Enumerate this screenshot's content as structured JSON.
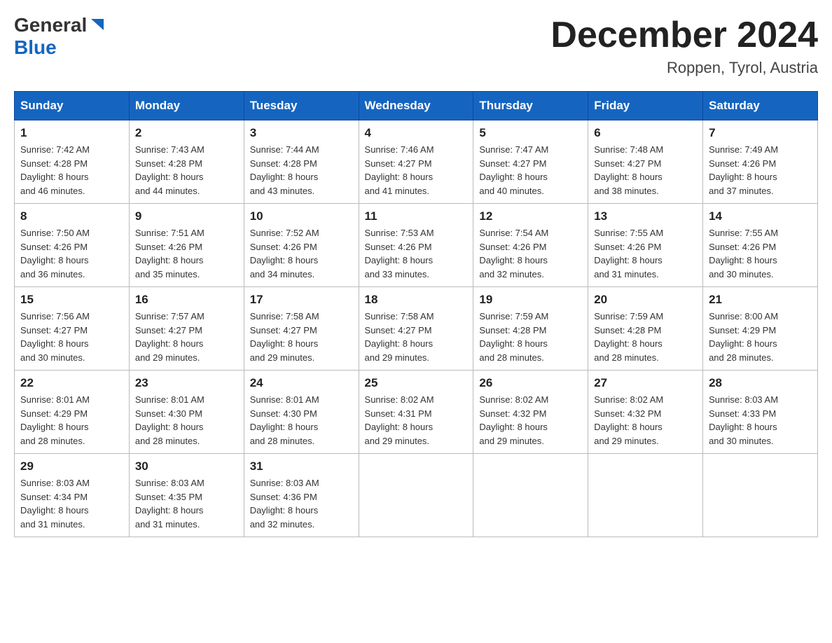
{
  "header": {
    "logo_general": "General",
    "logo_blue": "Blue",
    "month_title": "December 2024",
    "location": "Roppen, Tyrol, Austria"
  },
  "days_of_week": [
    "Sunday",
    "Monday",
    "Tuesday",
    "Wednesday",
    "Thursday",
    "Friday",
    "Saturday"
  ],
  "weeks": [
    [
      {
        "day": "1",
        "sunrise": "7:42 AM",
        "sunset": "4:28 PM",
        "daylight": "8 hours and 46 minutes."
      },
      {
        "day": "2",
        "sunrise": "7:43 AM",
        "sunset": "4:28 PM",
        "daylight": "8 hours and 44 minutes."
      },
      {
        "day": "3",
        "sunrise": "7:44 AM",
        "sunset": "4:28 PM",
        "daylight": "8 hours and 43 minutes."
      },
      {
        "day": "4",
        "sunrise": "7:46 AM",
        "sunset": "4:27 PM",
        "daylight": "8 hours and 41 minutes."
      },
      {
        "day": "5",
        "sunrise": "7:47 AM",
        "sunset": "4:27 PM",
        "daylight": "8 hours and 40 minutes."
      },
      {
        "day": "6",
        "sunrise": "7:48 AM",
        "sunset": "4:27 PM",
        "daylight": "8 hours and 38 minutes."
      },
      {
        "day": "7",
        "sunrise": "7:49 AM",
        "sunset": "4:26 PM",
        "daylight": "8 hours and 37 minutes."
      }
    ],
    [
      {
        "day": "8",
        "sunrise": "7:50 AM",
        "sunset": "4:26 PM",
        "daylight": "8 hours and 36 minutes."
      },
      {
        "day": "9",
        "sunrise": "7:51 AM",
        "sunset": "4:26 PM",
        "daylight": "8 hours and 35 minutes."
      },
      {
        "day": "10",
        "sunrise": "7:52 AM",
        "sunset": "4:26 PM",
        "daylight": "8 hours and 34 minutes."
      },
      {
        "day": "11",
        "sunrise": "7:53 AM",
        "sunset": "4:26 PM",
        "daylight": "8 hours and 33 minutes."
      },
      {
        "day": "12",
        "sunrise": "7:54 AM",
        "sunset": "4:26 PM",
        "daylight": "8 hours and 32 minutes."
      },
      {
        "day": "13",
        "sunrise": "7:55 AM",
        "sunset": "4:26 PM",
        "daylight": "8 hours and 31 minutes."
      },
      {
        "day": "14",
        "sunrise": "7:55 AM",
        "sunset": "4:26 PM",
        "daylight": "8 hours and 30 minutes."
      }
    ],
    [
      {
        "day": "15",
        "sunrise": "7:56 AM",
        "sunset": "4:27 PM",
        "daylight": "8 hours and 30 minutes."
      },
      {
        "day": "16",
        "sunrise": "7:57 AM",
        "sunset": "4:27 PM",
        "daylight": "8 hours and 29 minutes."
      },
      {
        "day": "17",
        "sunrise": "7:58 AM",
        "sunset": "4:27 PM",
        "daylight": "8 hours and 29 minutes."
      },
      {
        "day": "18",
        "sunrise": "7:58 AM",
        "sunset": "4:27 PM",
        "daylight": "8 hours and 29 minutes."
      },
      {
        "day": "19",
        "sunrise": "7:59 AM",
        "sunset": "4:28 PM",
        "daylight": "8 hours and 28 minutes."
      },
      {
        "day": "20",
        "sunrise": "7:59 AM",
        "sunset": "4:28 PM",
        "daylight": "8 hours and 28 minutes."
      },
      {
        "day": "21",
        "sunrise": "8:00 AM",
        "sunset": "4:29 PM",
        "daylight": "8 hours and 28 minutes."
      }
    ],
    [
      {
        "day": "22",
        "sunrise": "8:01 AM",
        "sunset": "4:29 PM",
        "daylight": "8 hours and 28 minutes."
      },
      {
        "day": "23",
        "sunrise": "8:01 AM",
        "sunset": "4:30 PM",
        "daylight": "8 hours and 28 minutes."
      },
      {
        "day": "24",
        "sunrise": "8:01 AM",
        "sunset": "4:30 PM",
        "daylight": "8 hours and 28 minutes."
      },
      {
        "day": "25",
        "sunrise": "8:02 AM",
        "sunset": "4:31 PM",
        "daylight": "8 hours and 29 minutes."
      },
      {
        "day": "26",
        "sunrise": "8:02 AM",
        "sunset": "4:32 PM",
        "daylight": "8 hours and 29 minutes."
      },
      {
        "day": "27",
        "sunrise": "8:02 AM",
        "sunset": "4:32 PM",
        "daylight": "8 hours and 29 minutes."
      },
      {
        "day": "28",
        "sunrise": "8:03 AM",
        "sunset": "4:33 PM",
        "daylight": "8 hours and 30 minutes."
      }
    ],
    [
      {
        "day": "29",
        "sunrise": "8:03 AM",
        "sunset": "4:34 PM",
        "daylight": "8 hours and 31 minutes."
      },
      {
        "day": "30",
        "sunrise": "8:03 AM",
        "sunset": "4:35 PM",
        "daylight": "8 hours and 31 minutes."
      },
      {
        "day": "31",
        "sunrise": "8:03 AM",
        "sunset": "4:36 PM",
        "daylight": "8 hours and 32 minutes."
      },
      null,
      null,
      null,
      null
    ]
  ],
  "labels": {
    "sunrise": "Sunrise:",
    "sunset": "Sunset:",
    "daylight": "Daylight:"
  }
}
